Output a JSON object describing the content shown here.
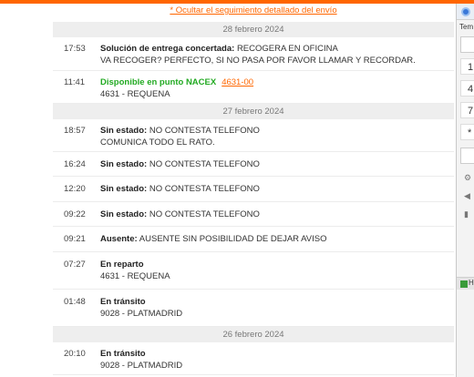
{
  "tracking": {
    "hide_link": "* Ocultar el seguimiento detallado del envío",
    "groups": [
      {
        "date": "28 febrero 2024",
        "events": [
          {
            "time": "17:53",
            "status": "Solución de entrega concertada:",
            "text_lines": [
              "RECOGERA EN OFICINA",
              "VA RECOGER? PERFECTO, SI NO PASA POR FAVOR LLAMAR Y RECORDAR."
            ]
          },
          {
            "time": "11:41",
            "status": "Disponible en punto NACEX",
            "link": "4631-00",
            "text_lines": [
              "",
              "4631 - REQUENA"
            ]
          }
        ]
      },
      {
        "date": "27 febrero 2024",
        "events": [
          {
            "time": "18:57",
            "status": "Sin estado:",
            "text_lines": [
              "NO CONTESTA TELEFONO",
              "COMUNICA TODO EL RATO."
            ]
          },
          {
            "time": "16:24",
            "status": "Sin estado:",
            "text_lines": [
              "NO CONTESTA TELEFONO"
            ]
          },
          {
            "time": "12:20",
            "status": "Sin estado:",
            "text_lines": [
              "NO CONTESTA TELEFONO"
            ]
          },
          {
            "time": "09:22",
            "status": "Sin estado:",
            "text_lines": [
              "NO CONTESTA TELEFONO"
            ]
          },
          {
            "time": "09:21",
            "status": "Ausente:",
            "text_lines": [
              "AUSENTE SIN POSIBILIDAD DE DEJAR AVISO"
            ]
          },
          {
            "time": "07:27",
            "status": "En reparto",
            "text_lines": [
              "",
              "4631 - REQUENA"
            ]
          },
          {
            "time": "01:48",
            "status": "En tránsito",
            "text_lines": [
              "",
              "9028 - PLATMADRID"
            ]
          }
        ]
      },
      {
        "date": "26 febrero 2024",
        "events": [
          {
            "time": "20:10",
            "status": "En tránsito",
            "text_lines": [
              "",
              "9028 - PLATMADRID"
            ]
          }
        ]
      }
    ]
  },
  "side_window": {
    "label": "Tem",
    "keys": [
      "1",
      "4",
      "7",
      "*"
    ],
    "status_text": "H"
  },
  "colors": {
    "accent": "#ff6600",
    "available_green": "#22aa22",
    "date_row_bg": "#eeeeee"
  }
}
